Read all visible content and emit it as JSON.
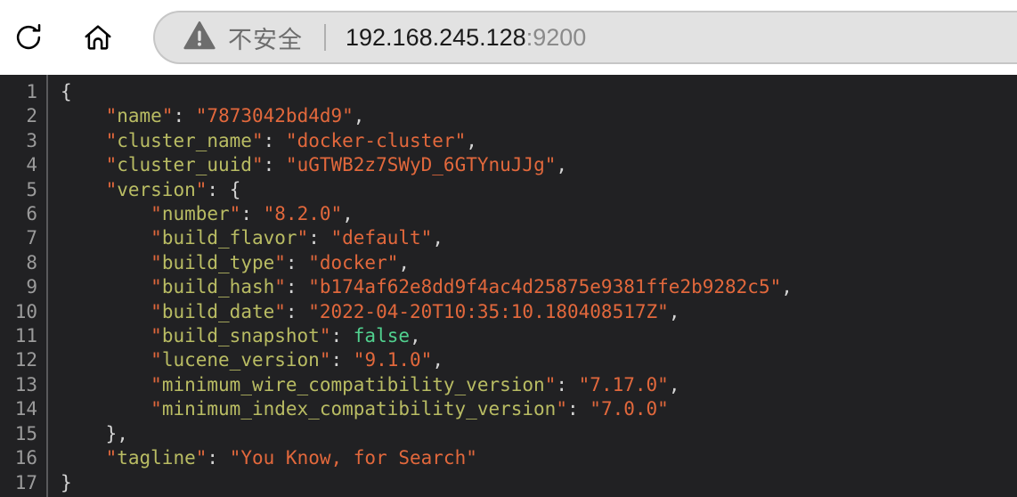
{
  "browser": {
    "reload_icon": "reload-icon",
    "home_icon": "home-icon",
    "address_bar": {
      "warning_icon": "warning-triangle-icon",
      "security_label": "不安全",
      "url_host": "192.168.245.128",
      "url_port": ":9200",
      "full_url": "192.168.245.128:9200"
    }
  },
  "json_viewer": {
    "theme": {
      "background": "#212123",
      "gutter_text": "#9b9b9b",
      "gutter_rule": "#5a5a5c",
      "key_color": "#b9bc63",
      "string_color": "#e2683c",
      "boolean_color": "#51d18f",
      "punctuation_color": "#d4d4d4"
    },
    "line_numbers": [
      1,
      2,
      3,
      4,
      5,
      6,
      7,
      8,
      9,
      10,
      11,
      12,
      13,
      14,
      15,
      16,
      17
    ],
    "lines": [
      {
        "indent": 0,
        "type": "open_brace",
        "text": "{"
      },
      {
        "indent": 1,
        "type": "pair",
        "key": "name",
        "value": "7873042bd4d9",
        "value_type": "string",
        "comma": true
      },
      {
        "indent": 1,
        "type": "pair",
        "key": "cluster_name",
        "value": "docker-cluster",
        "value_type": "string",
        "comma": true
      },
      {
        "indent": 1,
        "type": "pair",
        "key": "cluster_uuid",
        "value": "uGTWB2z7SWyD_6GTYnuJJg",
        "value_type": "string",
        "comma": true
      },
      {
        "indent": 1,
        "type": "open",
        "key": "version",
        "value": "{",
        "value_type": "brace",
        "comma": false
      },
      {
        "indent": 2,
        "type": "pair",
        "key": "number",
        "value": "8.2.0",
        "value_type": "string",
        "comma": true
      },
      {
        "indent": 2,
        "type": "pair",
        "key": "build_flavor",
        "value": "default",
        "value_type": "string",
        "comma": true
      },
      {
        "indent": 2,
        "type": "pair",
        "key": "build_type",
        "value": "docker",
        "value_type": "string",
        "comma": true
      },
      {
        "indent": 2,
        "type": "pair",
        "key": "build_hash",
        "value": "b174af62e8dd9f4ac4d25875e9381ffe2b9282c5",
        "value_type": "string",
        "comma": true
      },
      {
        "indent": 2,
        "type": "pair",
        "key": "build_date",
        "value": "2022-04-20T10:35:10.180408517Z",
        "value_type": "string",
        "comma": true
      },
      {
        "indent": 2,
        "type": "pair",
        "key": "build_snapshot",
        "value": "false",
        "value_type": "boolean",
        "comma": true
      },
      {
        "indent": 2,
        "type": "pair",
        "key": "lucene_version",
        "value": "9.1.0",
        "value_type": "string",
        "comma": true
      },
      {
        "indent": 2,
        "type": "pair",
        "key": "minimum_wire_compatibility_version",
        "value": "7.17.0",
        "value_type": "string",
        "comma": true
      },
      {
        "indent": 2,
        "type": "pair",
        "key": "minimum_index_compatibility_version",
        "value": "7.0.0",
        "value_type": "string",
        "comma": false
      },
      {
        "indent": 1,
        "type": "close",
        "text": "},"
      },
      {
        "indent": 1,
        "type": "pair",
        "key": "tagline",
        "value": "You Know, for Search",
        "value_type": "string",
        "comma": false
      },
      {
        "indent": 0,
        "type": "close_brace",
        "text": "}"
      }
    ]
  }
}
